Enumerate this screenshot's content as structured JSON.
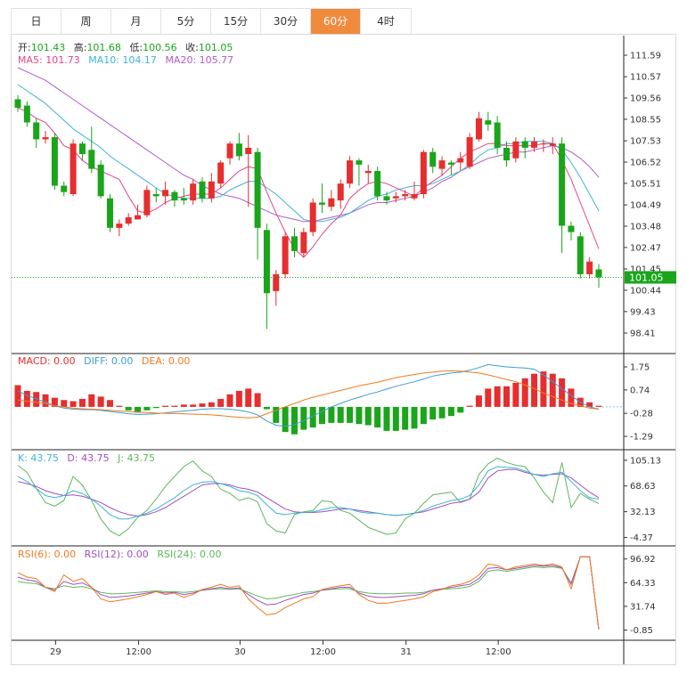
{
  "tabs": [
    {
      "label": "日",
      "active": false
    },
    {
      "label": "周",
      "active": false
    },
    {
      "label": "月",
      "active": false
    },
    {
      "label": "5分",
      "active": false
    },
    {
      "label": "15分",
      "active": false
    },
    {
      "label": "30分",
      "active": false
    },
    {
      "label": "60分",
      "active": true
    },
    {
      "label": "4时",
      "active": false
    }
  ],
  "ohlc_legend": {
    "open_label": "开:",
    "open": "101.43",
    "high_label": "高:",
    "high": "101.68",
    "low_label": "低:",
    "low": "100.56",
    "close_label": "收:",
    "close": "101.05"
  },
  "ma_legend": {
    "ma5": "MA5: 101.73",
    "ma10": "MA10: 104.17",
    "ma20": "MA20: 105.77"
  },
  "macd_legend": {
    "macd": "MACD: 0.00",
    "diff": "DIFF: 0.00",
    "dea": "DEA: 0.00"
  },
  "kdj_legend": {
    "k": "K: 43.75",
    "d": "D: 43.75",
    "j": "J: 43.75"
  },
  "rsi_legend": {
    "rsi6": "RSI(6): 0.00",
    "rsi12": "RSI(12): 0.00",
    "rsi24": "RSI(24): 0.00"
  },
  "last_price": "101.05",
  "colors": {
    "up": "#e62e2e",
    "down": "#1aa51a",
    "active_tab": "#f08b3e",
    "ma5": "#e0458a",
    "ma10": "#3cb4d8",
    "ma20": "#b05cc8",
    "diff": "#3c9bd6",
    "dea": "#f07a1e",
    "k": "#3cb4d8",
    "d": "#a050c0",
    "j": "#5cb85c",
    "rsi6": "#f07a1e",
    "rsi12": "#a050c0",
    "rsi24": "#5cb85c"
  },
  "chart_data": [
    {
      "type": "candlestick",
      "title": "",
      "x_tick_labels": [
        "29",
        "12:00",
        "30",
        "12:00",
        "31",
        "12:00"
      ],
      "y_tick_labels": [
        "111.59",
        "110.57",
        "109.56",
        "108.55",
        "107.53",
        "106.52",
        "105.51",
        "104.49",
        "103.48",
        "102.47",
        "101.45",
        "100.44",
        "99.43",
        "98.41"
      ],
      "ylim": [
        98.41,
        111.59
      ],
      "candles": [
        [
          109.5,
          109.1,
          109.7,
          108.9
        ],
        [
          109.2,
          108.4,
          109.4,
          108.2
        ],
        [
          108.4,
          107.6,
          108.6,
          107.2
        ],
        [
          107.6,
          107.7,
          108.0,
          107.4
        ],
        [
          107.7,
          105.4,
          107.9,
          105.2
        ],
        [
          105.4,
          105.1,
          105.6,
          104.9
        ],
        [
          105.0,
          107.4,
          107.6,
          104.9
        ],
        [
          107.4,
          106.9,
          107.5,
          106.6
        ],
        [
          107.1,
          106.2,
          108.2,
          106.0
        ],
        [
          106.4,
          104.9,
          106.6,
          104.8
        ],
        [
          104.8,
          103.4,
          105.0,
          103.2
        ],
        [
          103.4,
          103.6,
          103.8,
          103.0
        ],
        [
          103.6,
          103.9,
          104.1,
          103.5
        ],
        [
          103.8,
          104.0,
          104.5,
          103.8
        ],
        [
          104.0,
          105.2,
          105.4,
          103.9
        ],
        [
          105.0,
          104.9,
          105.3,
          104.6
        ],
        [
          104.9,
          105.2,
          105.6,
          104.5
        ],
        [
          105.1,
          104.7,
          105.2,
          104.4
        ],
        [
          104.8,
          104.7,
          105.3,
          104.5
        ],
        [
          104.7,
          105.5,
          105.7,
          104.5
        ],
        [
          105.6,
          104.8,
          105.8,
          104.6
        ],
        [
          104.8,
          105.6,
          106.0,
          104.6
        ],
        [
          105.5,
          106.5,
          106.6,
          105.3
        ],
        [
          106.7,
          107.4,
          107.5,
          106.4
        ],
        [
          107.4,
          106.8,
          107.9,
          106.6
        ],
        [
          106.9,
          107.2,
          107.8,
          104.4
        ],
        [
          107.0,
          103.4,
          107.2,
          101.9
        ],
        [
          103.3,
          100.3,
          103.6,
          98.6
        ],
        [
          100.4,
          101.2,
          101.4,
          99.7
        ],
        [
          101.2,
          103.0,
          103.2,
          101.0
        ],
        [
          103.0,
          102.3,
          103.4,
          102.0
        ],
        [
          102.2,
          103.2,
          103.4,
          102.0
        ],
        [
          103.2,
          104.6,
          104.8,
          103.0
        ],
        [
          104.6,
          104.5,
          105.5,
          104.1
        ],
        [
          104.4,
          104.8,
          105.2,
          104.2
        ],
        [
          104.7,
          105.5,
          105.7,
          104.3
        ],
        [
          105.5,
          106.6,
          106.8,
          105.3
        ],
        [
          106.6,
          106.4,
          106.7,
          105.4
        ],
        [
          106.0,
          106.1,
          106.4,
          105.5
        ],
        [
          106.1,
          104.9,
          106.3,
          104.7
        ],
        [
          104.9,
          104.7,
          105.1,
          104.5
        ],
        [
          104.8,
          104.9,
          105.1,
          104.6
        ],
        [
          104.9,
          105.0,
          105.2,
          104.7
        ],
        [
          104.8,
          105.0,
          105.6,
          104.7
        ],
        [
          105.0,
          107.0,
          107.1,
          104.8
        ],
        [
          107.0,
          106.3,
          107.2,
          106.0
        ],
        [
          106.2,
          106.6,
          106.8,
          105.9
        ],
        [
          106.5,
          106.4,
          106.6,
          105.9
        ],
        [
          106.5,
          106.7,
          107.0,
          106.1
        ],
        [
          106.3,
          107.7,
          107.9,
          106.2
        ],
        [
          107.6,
          108.6,
          108.9,
          107.5
        ],
        [
          108.5,
          108.3,
          108.9,
          108.0
        ],
        [
          108.4,
          107.2,
          108.7,
          106.9
        ],
        [
          107.2,
          106.6,
          107.5,
          106.3
        ],
        [
          106.7,
          107.5,
          107.7,
          106.5
        ],
        [
          107.5,
          107.2,
          107.7,
          106.7
        ],
        [
          107.2,
          107.5,
          107.7,
          107.0
        ],
        [
          107.4,
          107.4,
          107.6,
          107.0
        ],
        [
          107.3,
          107.4,
          107.7,
          106.9
        ],
        [
          107.4,
          103.5,
          107.7,
          102.2
        ],
        [
          103.5,
          103.2,
          103.7,
          102.8
        ],
        [
          103.0,
          101.2,
          103.2,
          101.0
        ],
        [
          101.2,
          101.8,
          102.0,
          101.0
        ],
        [
          101.43,
          101.05,
          101.68,
          100.56
        ]
      ],
      "ma5": [
        109.1,
        108.9,
        108.6,
        108.4,
        107.9,
        107.3,
        107.1,
        106.6,
        106.3,
        106.1,
        105.9,
        105.7,
        104.9,
        104.2,
        104.1,
        104.3,
        104.6,
        104.8,
        104.9,
        105.0,
        105.0,
        105.0,
        105.3,
        105.7,
        106.1,
        106.3,
        106.2,
        105.1,
        104.1,
        103.2,
        102.4,
        102.0,
        102.5,
        103.1,
        103.6,
        104.0,
        104.8,
        105.2,
        105.5,
        105.6,
        105.5,
        105.3,
        105.1,
        104.9,
        105.3,
        105.6,
        105.9,
        106.3,
        106.7,
        107.0,
        107.2,
        107.4,
        107.4,
        107.3,
        107.3,
        107.3,
        107.3,
        107.4,
        107.4,
        106.6,
        105.7,
        104.6,
        103.5,
        102.4
      ],
      "ma10": [
        110.2,
        109.9,
        109.6,
        109.3,
        108.9,
        108.5,
        108.1,
        107.8,
        107.5,
        107.2,
        106.8,
        106.5,
        106.2,
        105.9,
        105.6,
        105.3,
        105.0,
        104.9,
        104.8,
        104.8,
        104.8,
        104.8,
        104.9,
        105.2,
        105.4,
        105.6,
        105.6,
        105.3,
        105.0,
        104.6,
        104.2,
        103.8,
        103.7,
        103.7,
        103.8,
        103.9,
        104.1,
        104.4,
        104.7,
        104.9,
        105.0,
        105.2,
        105.3,
        105.4,
        105.4,
        105.5,
        105.7,
        105.9,
        106.1,
        106.4,
        106.8,
        107.1,
        107.2,
        107.4,
        107.4,
        107.5,
        107.5,
        107.5,
        107.4,
        107.1,
        106.5,
        105.8,
        105.0,
        104.2
      ],
      "ma20": [
        111.0,
        110.8,
        110.6,
        110.4,
        110.1,
        109.8,
        109.5,
        109.2,
        108.9,
        108.6,
        108.3,
        108.0,
        107.7,
        107.4,
        107.1,
        106.8,
        106.5,
        106.2,
        105.9,
        105.7,
        105.4,
        105.2,
        105.0,
        104.9,
        104.8,
        104.6,
        104.4,
        104.2,
        104.0,
        103.9,
        103.8,
        103.7,
        103.7,
        103.8,
        103.9,
        104.0,
        104.1,
        104.3,
        104.5,
        104.6,
        104.6,
        104.7,
        104.8,
        104.9,
        105.1,
        105.3,
        105.6,
        105.8,
        106.1,
        106.3,
        106.5,
        106.7,
        106.8,
        106.9,
        107.0,
        107.0,
        107.1,
        107.2,
        107.3,
        107.2,
        107.0,
        106.7,
        106.3,
        105.8
      ]
    },
    {
      "type": "bar",
      "title": "",
      "y_tick_labels": [
        "1.75",
        "0.74",
        "-0.28",
        "-1.29"
      ],
      "ylim": [
        -1.6,
        2.1
      ],
      "macd": [
        0.95,
        0.7,
        0.65,
        0.55,
        0.4,
        0.3,
        0.25,
        0.35,
        0.55,
        0.45,
        0.3,
        0.05,
        -0.15,
        -0.25,
        -0.15,
        -0.05,
        0.05,
        0.05,
        0.1,
        0.1,
        0.15,
        0.2,
        0.35,
        0.55,
        0.7,
        0.8,
        0.6,
        -0.1,
        -0.7,
        -1.1,
        -1.2,
        -1.0,
        -0.9,
        -0.75,
        -0.7,
        -0.7,
        -0.7,
        -0.75,
        -0.8,
        -0.9,
        -1.05,
        -1.05,
        -1.0,
        -0.95,
        -0.75,
        -0.55,
        -0.5,
        -0.4,
        -0.25,
        0.05,
        0.5,
        0.8,
        0.9,
        0.9,
        1.05,
        1.25,
        1.45,
        1.55,
        1.45,
        1.25,
        0.8,
        0.4,
        0.2,
        0.05
      ],
      "diff": [
        0.7,
        0.5,
        0.35,
        0.2,
        0.05,
        -0.05,
        -0.1,
        -0.12,
        -0.12,
        -0.15,
        -0.2,
        -0.25,
        -0.3,
        -0.33,
        -0.32,
        -0.3,
        -0.26,
        -0.22,
        -0.18,
        -0.15,
        -0.1,
        -0.08,
        -0.08,
        -0.1,
        -0.15,
        -0.22,
        -0.35,
        -0.62,
        -0.8,
        -0.85,
        -0.78,
        -0.6,
        -0.4,
        -0.2,
        0.0,
        0.15,
        0.3,
        0.42,
        0.55,
        0.65,
        0.78,
        0.9,
        1.0,
        1.1,
        1.22,
        1.35,
        1.42,
        1.48,
        1.52,
        1.6,
        1.72,
        1.85,
        1.8,
        1.75,
        1.72,
        1.7,
        1.65,
        1.4,
        1.1,
        0.8,
        0.5,
        0.2,
        0.0,
        -0.1
      ],
      "dea": [
        0.3,
        0.25,
        0.2,
        0.15,
        0.05,
        0.0,
        -0.05,
        -0.08,
        -0.1,
        -0.12,
        -0.15,
        -0.18,
        -0.2,
        -0.23,
        -0.25,
        -0.27,
        -0.28,
        -0.29,
        -0.3,
        -0.32,
        -0.33,
        -0.35,
        -0.38,
        -0.42,
        -0.45,
        -0.48,
        -0.45,
        -0.3,
        -0.15,
        0.0,
        0.15,
        0.3,
        0.42,
        0.52,
        0.62,
        0.72,
        0.82,
        0.92,
        1.0,
        1.08,
        1.18,
        1.28,
        1.35,
        1.42,
        1.48,
        1.52,
        1.56,
        1.58,
        1.56,
        1.52,
        1.48,
        1.4,
        1.3,
        1.2,
        1.1,
        0.95,
        0.8,
        0.6,
        0.45,
        0.3,
        0.15,
        0.05,
        -0.05,
        -0.1
      ]
    },
    {
      "type": "line",
      "title": "",
      "y_tick_labels": [
        "105.13",
        "68.63",
        "32.13",
        "-4.37"
      ],
      "ylim": [
        -10,
        115
      ],
      "k": [
        82,
        75,
        65,
        55,
        52,
        55,
        62,
        58,
        50,
        40,
        28,
        22,
        22,
        26,
        30,
        36,
        44,
        52,
        62,
        70,
        74,
        75,
        72,
        68,
        62,
        60,
        55,
        42,
        30,
        28,
        30,
        31,
        32,
        35,
        38,
        38,
        36,
        32,
        30,
        30,
        28,
        27,
        28,
        30,
        34,
        40,
        44,
        48,
        50,
        55,
        70,
        90,
        96,
        95,
        94,
        90,
        85,
        82,
        86,
        88,
        75,
        62,
        52,
        50
      ],
      "d": [
        75,
        72,
        68,
        62,
        58,
        55,
        56,
        54,
        50,
        45,
        38,
        32,
        28,
        26,
        28,
        32,
        38,
        46,
        54,
        62,
        70,
        72,
        72,
        70,
        66,
        64,
        60,
        52,
        44,
        36,
        32,
        31,
        31,
        32,
        34,
        36,
        36,
        34,
        32,
        30,
        28,
        27,
        28,
        30,
        32,
        36,
        40,
        44,
        46,
        50,
        60,
        80,
        90,
        92,
        92,
        88,
        85,
        84,
        85,
        86,
        80,
        70,
        60,
        52
      ],
      "j": [
        98,
        88,
        65,
        45,
        40,
        48,
        82,
        70,
        48,
        22,
        5,
        -2,
        8,
        24,
        34,
        50,
        68,
        82,
        96,
        104,
        90,
        82,
        64,
        58,
        48,
        52,
        46,
        15,
        5,
        2,
        28,
        32,
        34,
        48,
        46,
        34,
        30,
        20,
        10,
        5,
        0,
        2,
        22,
        30,
        44,
        56,
        58,
        60,
        45,
        50,
        85,
        100,
        108,
        102,
        98,
        96,
        80,
        60,
        45,
        102,
        38,
        58,
        50,
        43.75
      ]
    },
    {
      "type": "line",
      "title": "",
      "y_tick_labels": [
        "96.92",
        "64.33",
        "31.74",
        "-0.85"
      ],
      "ylim": [
        -10,
        110
      ],
      "rsi6": [
        78,
        72,
        70,
        58,
        52,
        75,
        66,
        70,
        58,
        42,
        38,
        40,
        42,
        45,
        48,
        52,
        48,
        50,
        44,
        48,
        55,
        58,
        62,
        58,
        60,
        42,
        30,
        20,
        22,
        30,
        36,
        42,
        45,
        55,
        58,
        60,
        62,
        48,
        40,
        36,
        36,
        38,
        40,
        42,
        45,
        52,
        55,
        60,
        62,
        66,
        75,
        90,
        88,
        82,
        86,
        88,
        90,
        88,
        90,
        86,
        56,
        100,
        100,
        0
      ],
      "rsi12": [
        72,
        68,
        66,
        58,
        54,
        66,
        62,
        64,
        58,
        48,
        44,
        45,
        46,
        48,
        50,
        52,
        50,
        51,
        48,
        50,
        54,
        56,
        58,
        56,
        57,
        48,
        40,
        34,
        35,
        40,
        44,
        48,
        50,
        54,
        56,
        58,
        58,
        50,
        46,
        44,
        44,
        45,
        46,
        47,
        49,
        54,
        56,
        58,
        60,
        62,
        70,
        84,
        85,
        82,
        84,
        86,
        88,
        87,
        88,
        85,
        62,
        100,
        100,
        0
      ],
      "rsi24": [
        66,
        64,
        63,
        58,
        56,
        60,
        58,
        59,
        56,
        51,
        49,
        49,
        50,
        51,
        52,
        53,
        52,
        52,
        51,
        52,
        54,
        55,
        56,
        55,
        56,
        51,
        46,
        42,
        43,
        46,
        48,
        51,
        52,
        54,
        55,
        56,
        56,
        52,
        50,
        49,
        49,
        49,
        50,
        50,
        51,
        54,
        55,
        56,
        57,
        59,
        66,
        80,
        82,
        80,
        82,
        84,
        86,
        85,
        86,
        84,
        64,
        100,
        100,
        0
      ]
    }
  ]
}
